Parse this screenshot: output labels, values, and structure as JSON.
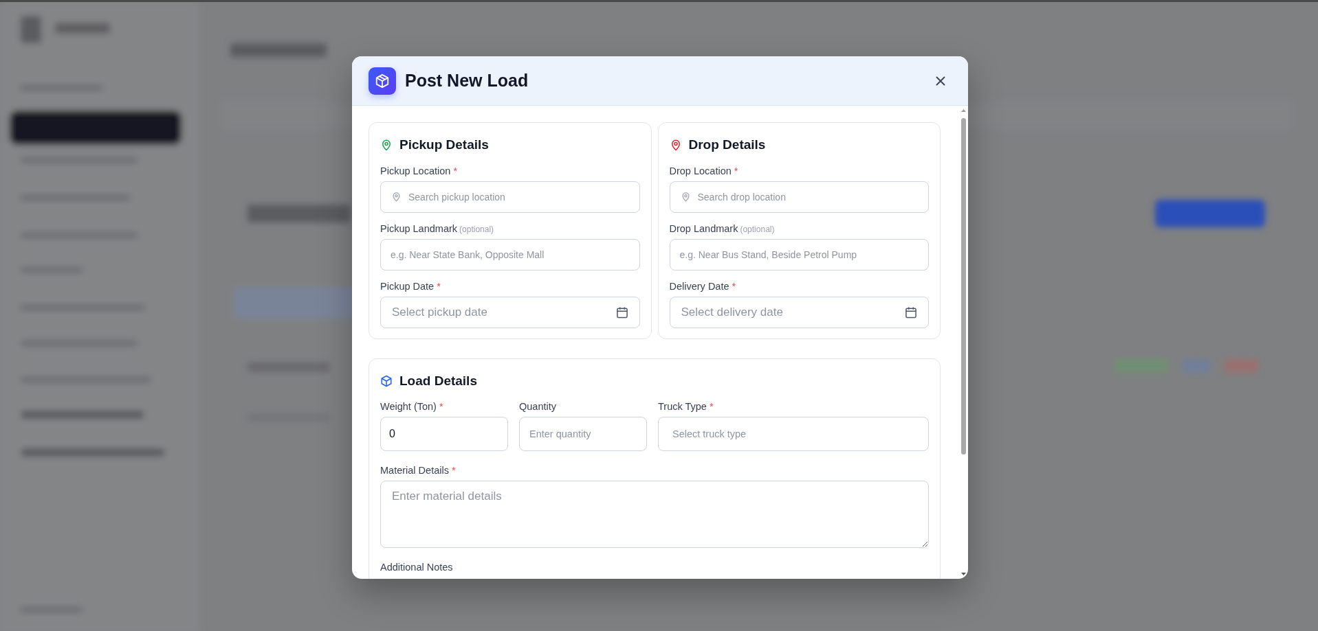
{
  "dialog": {
    "title": "Post New Load"
  },
  "sections": [
    {
      "color": "#16a34a",
      "title": "Pickup Details",
      "fields": [
        {
          "kind": "search",
          "label": "Pickup Location",
          "required_mark": "*",
          "placeholder": "Search pickup location"
        },
        {
          "kind": "text",
          "label": "Pickup Landmark",
          "hint": "(optional)",
          "placeholder": "e.g. Near State Bank, Opposite Mall"
        },
        {
          "kind": "date",
          "label": "Pickup Date",
          "required_mark": "*",
          "placeholder": "Select pickup date"
        }
      ]
    },
    {
      "color": "#dc2626",
      "title": "Drop Details",
      "fields": [
        {
          "kind": "search",
          "label": "Drop Location",
          "required_mark": "*",
          "placeholder": "Search drop location"
        },
        {
          "kind": "text",
          "label": "Drop Landmark",
          "hint": "(optional)",
          "placeholder": "e.g. Near Bus Stand, Beside Petrol Pump"
        },
        {
          "kind": "date",
          "label": "Delivery Date",
          "required_mark": "*",
          "placeholder": "Select delivery date"
        }
      ]
    }
  ],
  "load_details": {
    "title": "Load Details",
    "fields": [
      {
        "kind": "number",
        "label": "Weight (Ton)",
        "required_mark": "*",
        "value": "0"
      },
      {
        "kind": "number",
        "label": "Quantity",
        "placeholder": "Enter quantity"
      },
      {
        "kind": "select",
        "label": "Truck Type",
        "required_mark": "*",
        "placeholder": "Select truck type"
      },
      {
        "kind": "textarea",
        "label": "Material Details",
        "required_mark": "*",
        "placeholder": "Enter material details"
      },
      {
        "kind": "label",
        "label": "Additional Notes"
      }
    ]
  }
}
